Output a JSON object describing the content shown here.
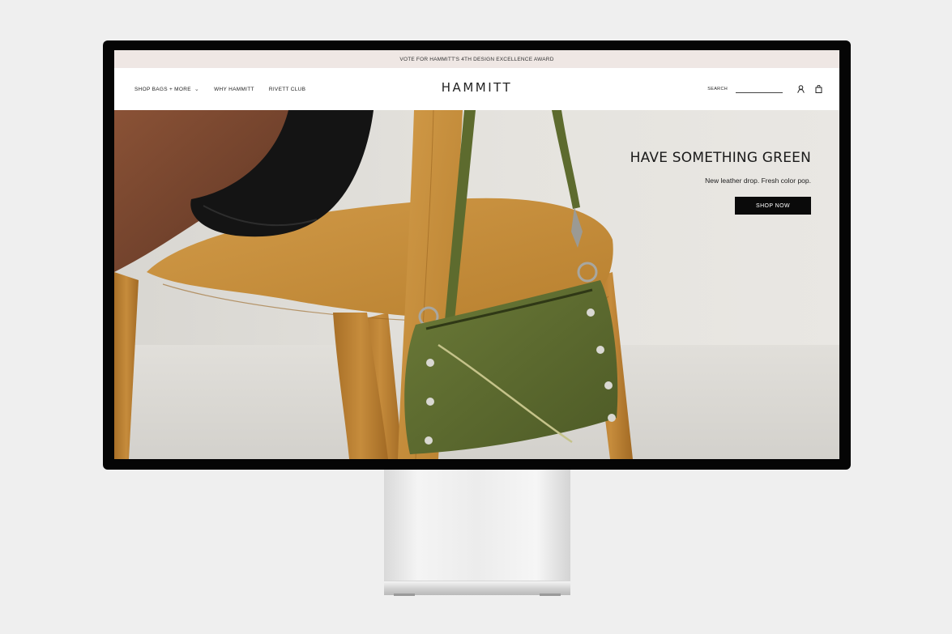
{
  "announcement": {
    "text": "VOTE FOR HAMMITT'S 4TH DESIGN EXCELLENCE AWARD"
  },
  "header": {
    "logo": "HAMMITT",
    "nav": [
      {
        "label": "SHOP BAGS + MORE",
        "has_dropdown": true
      },
      {
        "label": "WHY HAMMITT"
      },
      {
        "label": "RIVETT CLUB"
      }
    ],
    "search_label": "SEARCH",
    "search_value": "",
    "icons": [
      "account-icon",
      "cart-icon"
    ]
  },
  "hero": {
    "title": "HAVE SOMETHING GREEN",
    "subtitle": "New leather drop. Fresh color pop.",
    "cta": "SHOP NOW",
    "image": "model-seated-on-tan-leather-chair-with-green-studded-shoulder-bag"
  },
  "colors": {
    "announcement_bg": "#efe7e4",
    "button_bg": "#0a0a0a",
    "bag_green": "#5b6a2f",
    "chair_tan": "#c8913f",
    "backdrop": "#e4e2de"
  }
}
